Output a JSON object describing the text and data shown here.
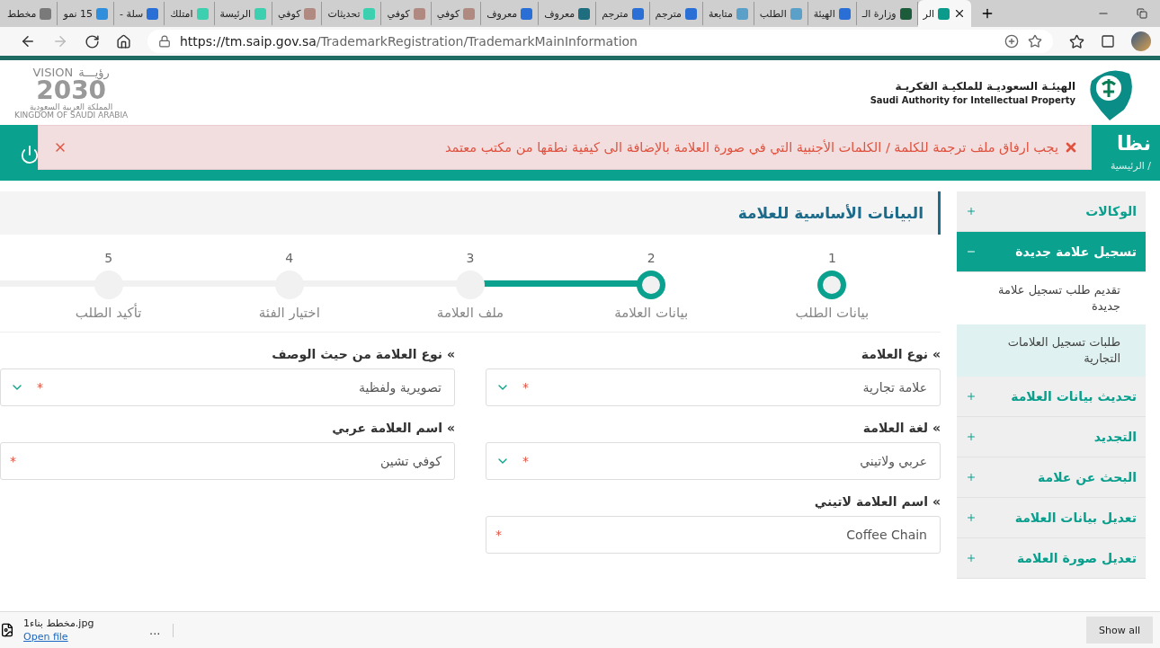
{
  "browser": {
    "tabs": [
      {
        "label": "الر",
        "selected": true,
        "color": "#0b9b8a"
      },
      {
        "label": "وزارة الـ",
        "selected": false,
        "color": "#1d5c3a"
      },
      {
        "label": "الهيئة",
        "selected": false,
        "color": "#2a6fd6"
      },
      {
        "label": "الطلب",
        "selected": false,
        "color": "#5aa0c8"
      },
      {
        "label": "متابعة",
        "selected": false,
        "color": "#5aa0c8"
      },
      {
        "label": "مترجم",
        "selected": false,
        "color": "#2a6fd6"
      },
      {
        "label": "مترجم",
        "selected": false,
        "color": "#2a6fd6"
      },
      {
        "label": "معروف",
        "selected": false,
        "color": "#1e6e80"
      },
      {
        "label": "معروف",
        "selected": false,
        "color": "#2a6fd6"
      },
      {
        "label": "كوفي",
        "selected": false,
        "color": "#b08a80"
      },
      {
        "label": "كوفي",
        "selected": false,
        "color": "#b08a80"
      },
      {
        "label": "تحديثات",
        "selected": false,
        "color": "#3ccfb0"
      },
      {
        "label": "كوفي",
        "selected": false,
        "color": "#b08a80"
      },
      {
        "label": "الرئيسة",
        "selected": false,
        "color": "#3ccfb0"
      },
      {
        "label": "امتلك",
        "selected": false,
        "color": "#3ccfb0"
      },
      {
        "label": "سلة -",
        "selected": false,
        "color": "#2a6fd6"
      },
      {
        "label": "15 نمو",
        "selected": false,
        "color": "#2f8fdd"
      },
      {
        "label": "مخطط",
        "selected": false,
        "color": "#7a7a7a"
      }
    ],
    "url_host": "https://tm.saip.gov.sa",
    "url_path": "/TrademarkRegistration/TrademarkMainInformation"
  },
  "header": {
    "vision_logo": {
      "vision": "VISION",
      "ruya": "رؤيـــة",
      "year": "2030",
      "country_ar": "المملكة العربية السعودية",
      "country_en": "KINGDOM OF SAUDI ARABIA"
    },
    "authority_logo": {
      "name_ar": "الهيئـة السعوديـة للملكيـة الفكريـة",
      "name_en": "Saudi Authority for Intellectual Property"
    },
    "system_title": "نظا",
    "breadcrumb": "الرئيسية /"
  },
  "alert": {
    "message": "يجب ارفاق ملف ترجمة للكلمة / الكلمات الأجنبية التي في صورة العلامة بالإضافة الى كيفية نطقها من مكتب معتمد"
  },
  "sidebar": {
    "items": [
      {
        "label": "الوكالات",
        "expanded": false
      },
      {
        "label": "تسجيل علامة جديدة",
        "expanded": true,
        "children": [
          {
            "label": "تقديم طلب تسجيل علامة جديدة",
            "selected": false
          },
          {
            "label": "طلبات تسجيل العلامات التجارية",
            "selected": true
          }
        ]
      },
      {
        "label": "تحديث بيانات العلامة",
        "expanded": false
      },
      {
        "label": "التجديد",
        "expanded": false
      },
      {
        "label": "البحث عن علامة",
        "expanded": false
      },
      {
        "label": "تعديل بيانات العلامة",
        "expanded": false
      },
      {
        "label": "تعديل صورة العلامة",
        "expanded": false
      }
    ]
  },
  "page_title": "البيانات الأساسية للعلامة",
  "steps": [
    {
      "number": "1",
      "label": "بيانات الطلب",
      "active": true
    },
    {
      "number": "2",
      "label": "بيانات العلامة",
      "active": true
    },
    {
      "number": "3",
      "label": "ملف العلامة",
      "active": false
    },
    {
      "number": "4",
      "label": "اختيار الفئة",
      "active": false
    },
    {
      "number": "5",
      "label": "تأكيد الطلب",
      "active": false
    }
  ],
  "fields": [
    {
      "label": "» نوع العلامة",
      "value": "علامة تجارية",
      "kind": "select",
      "required_mark": "*"
    },
    {
      "label": "» نوع العلامة من حيث الوصف",
      "value": "تصويرية ولفظية",
      "kind": "select",
      "required_mark": "*"
    },
    {
      "label": "» لغة العلامة",
      "value": "عربي ولاتيني",
      "kind": "select",
      "required_mark": "*"
    },
    {
      "label": "» اسم العلامة عربي",
      "value": "كوفي تشين",
      "kind": "text",
      "required_mark": "*"
    },
    {
      "label": "» اسم العلامة لاتيني",
      "value": "Coffee Chain",
      "kind": "text",
      "required_mark": "*"
    }
  ],
  "download_bar": {
    "file": "مخطط بناء1.jpg",
    "open": "Open file",
    "more": "...",
    "show_all": "Show all"
  }
}
